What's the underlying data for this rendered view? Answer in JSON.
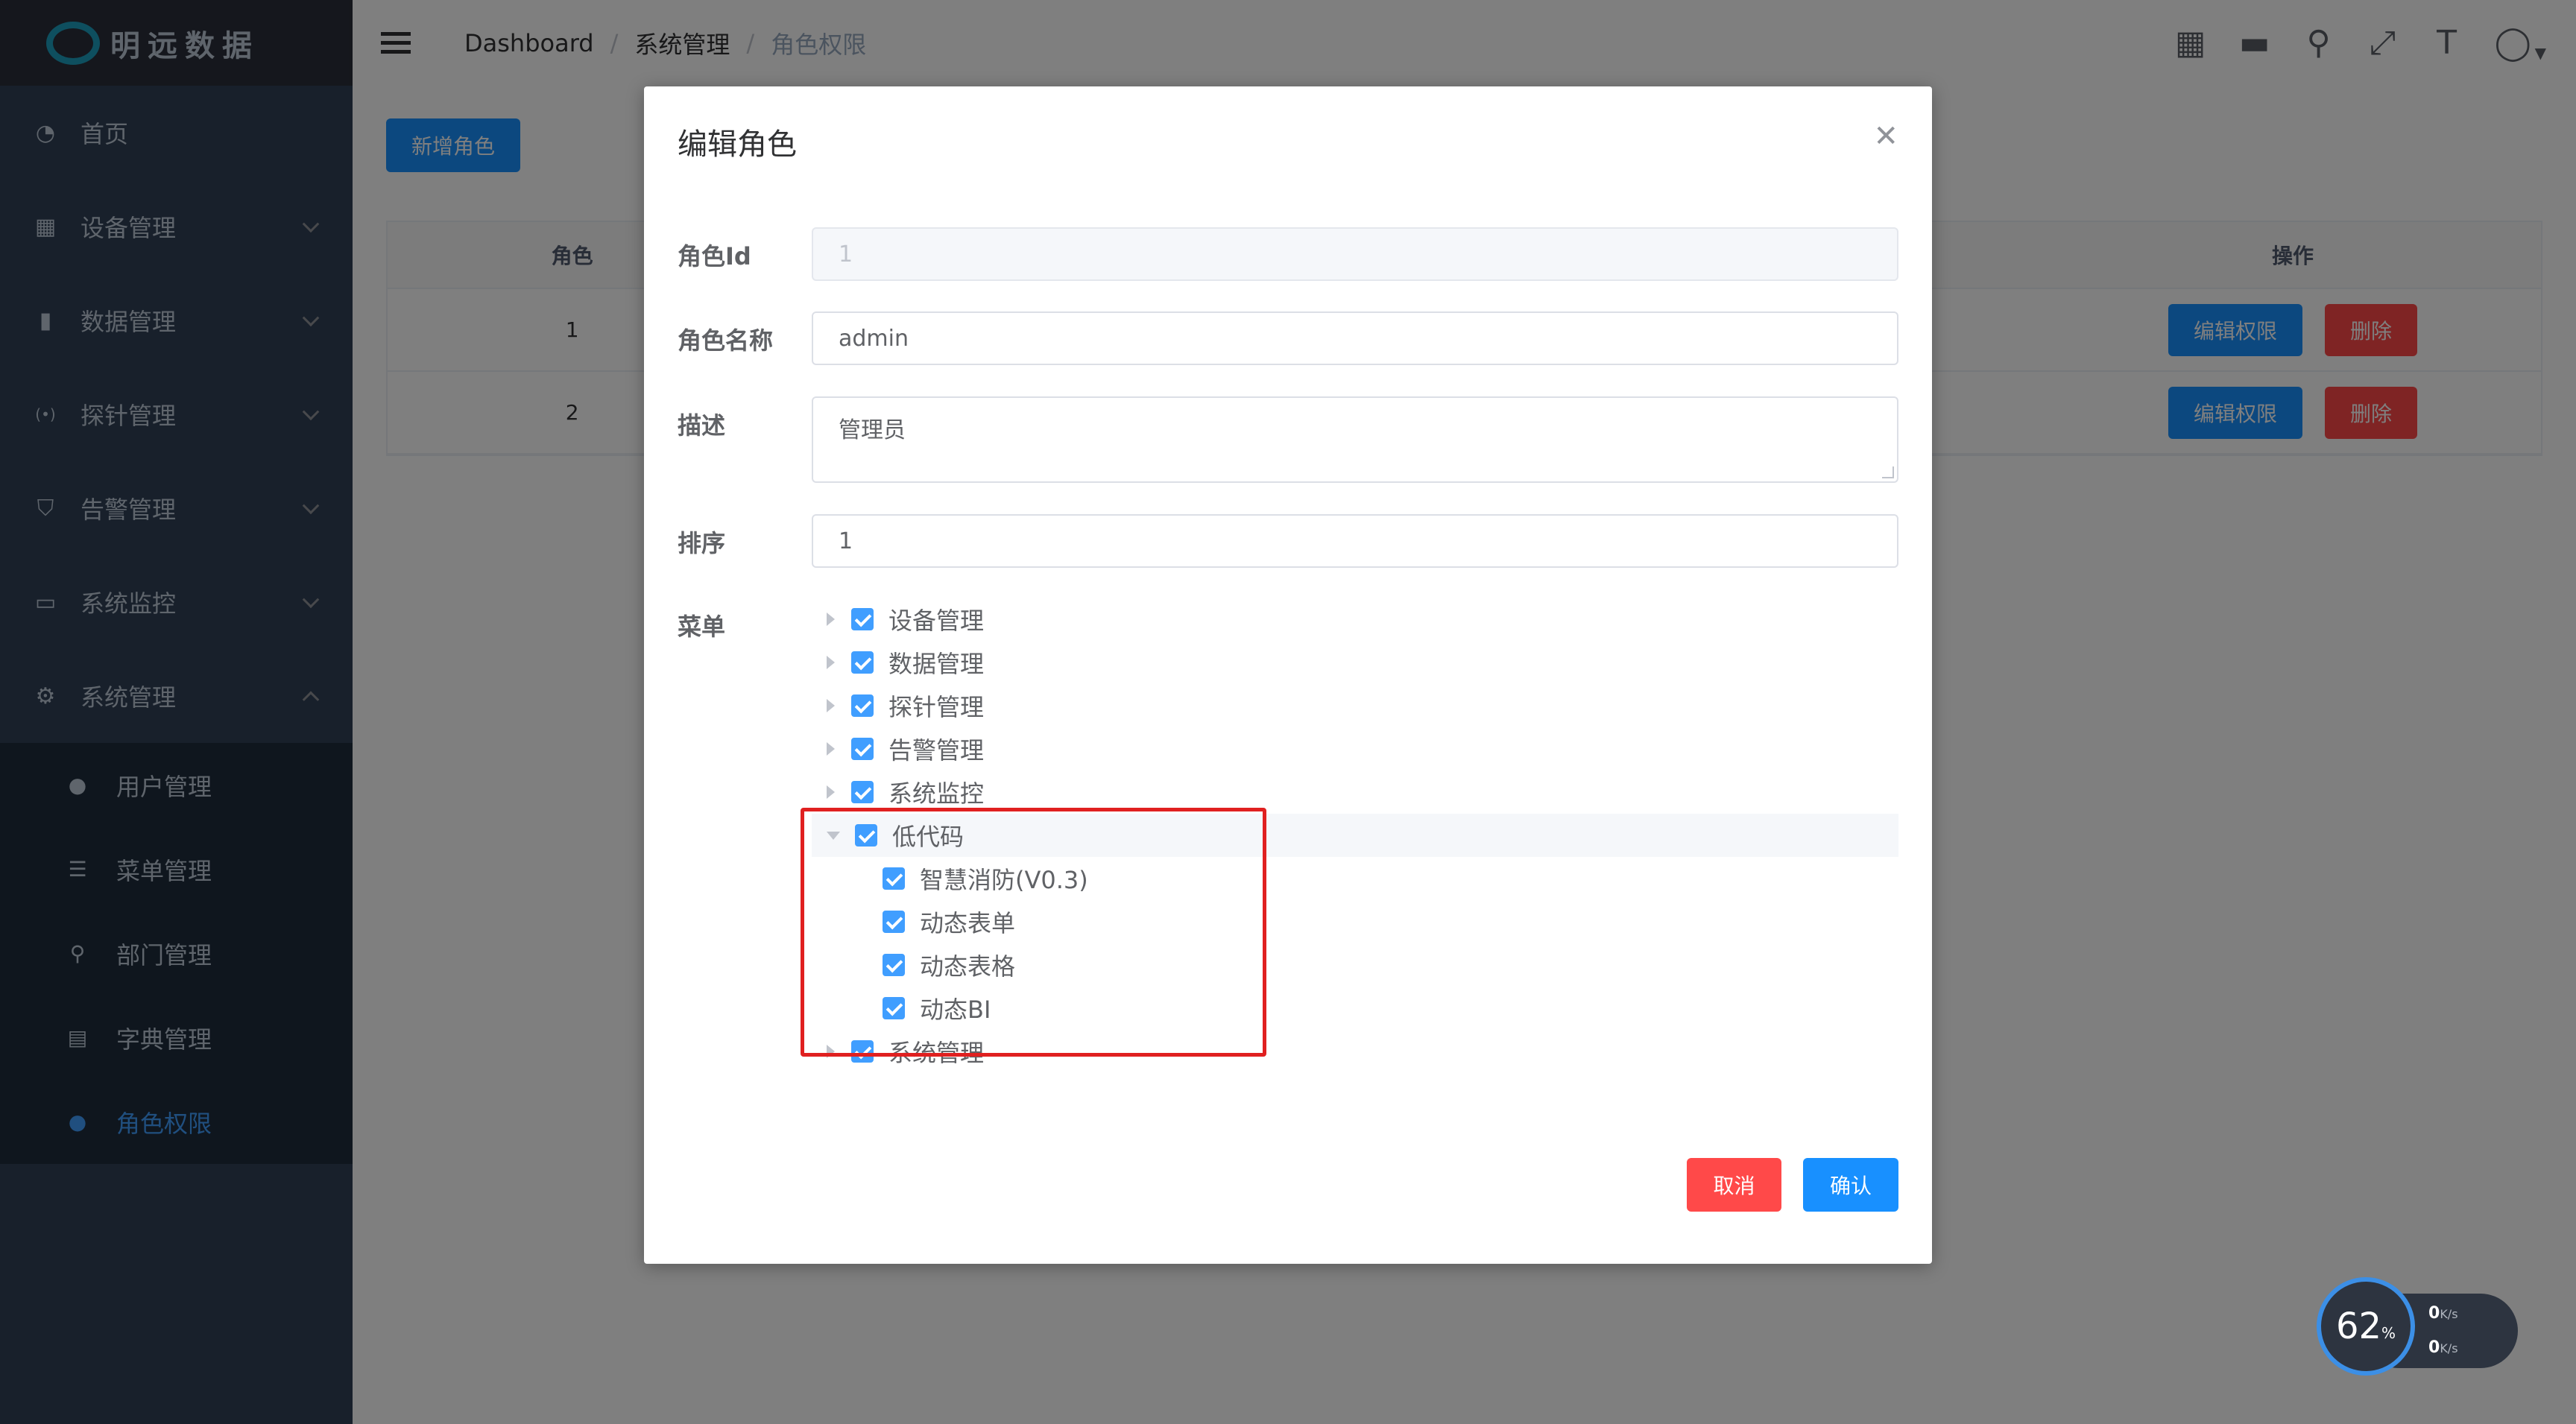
{
  "app": {
    "logo_text": "明远数据"
  },
  "sidebar": {
    "items": [
      {
        "label": "首页",
        "icon": "dashboard-icon"
      },
      {
        "label": "设备管理",
        "icon": "grid-icon"
      },
      {
        "label": "数据管理",
        "icon": "book-icon"
      },
      {
        "label": "探针管理",
        "icon": "signal-icon"
      },
      {
        "label": "告警管理",
        "icon": "shield-icon"
      },
      {
        "label": "系统监控",
        "icon": "monitor-icon"
      },
      {
        "label": "系统管理",
        "icon": "gear-icon"
      }
    ],
    "subitems": [
      {
        "label": "用户管理",
        "icon": "user-icon"
      },
      {
        "label": "菜单管理",
        "icon": "tree-table-icon"
      },
      {
        "label": "部门管理",
        "icon": "org-icon"
      },
      {
        "label": "字典管理",
        "icon": "dict-icon"
      },
      {
        "label": "角色权限",
        "icon": "peoples-icon",
        "active": true
      }
    ]
  },
  "header": {
    "breadcrumb": [
      "Dashboard",
      "系统管理",
      "角色权限"
    ]
  },
  "main": {
    "add_button": "新增角色",
    "table": {
      "headers": [
        "角色",
        "",
        "操作"
      ],
      "rows": [
        {
          "role": "1",
          "edit": "编辑权限",
          "delete": "删除"
        },
        {
          "role": "2",
          "edit": "编辑权限",
          "delete": "删除"
        }
      ]
    }
  },
  "dialog": {
    "title": "编辑角色",
    "fields": {
      "role_id": {
        "label": "角色Id",
        "value": "1"
      },
      "role_name": {
        "label": "角色名称",
        "value": "admin"
      },
      "description": {
        "label": "描述",
        "value": "管理员"
      },
      "sort": {
        "label": "排序",
        "value": "1"
      },
      "menu": {
        "label": "菜单"
      }
    },
    "tree": [
      {
        "label": "设备管理",
        "checked": true,
        "expanded": false
      },
      {
        "label": "数据管理",
        "checked": true,
        "expanded": false
      },
      {
        "label": "探针管理",
        "checked": true,
        "expanded": false
      },
      {
        "label": "告警管理",
        "checked": true,
        "expanded": false
      },
      {
        "label": "系统监控",
        "checked": true,
        "expanded": false
      },
      {
        "label": "低代码",
        "checked": true,
        "expanded": true,
        "children": [
          {
            "label": "智慧消防(V0.3)",
            "checked": true
          },
          {
            "label": "动态表单",
            "checked": true
          },
          {
            "label": "动态表格",
            "checked": true
          },
          {
            "label": "动态BI",
            "checked": true
          }
        ]
      },
      {
        "label": "系统管理",
        "checked": true,
        "expanded": false
      }
    ],
    "cancel": "取消",
    "confirm": "确认"
  },
  "speed_widget": {
    "percent": "62",
    "percent_sign": "%",
    "up": "0",
    "down": "0",
    "unit": "K/s"
  },
  "colors": {
    "primary": "#1890ff",
    "danger": "#ff4949",
    "sidebar": "#304156",
    "highlight_box": "#e02020"
  }
}
